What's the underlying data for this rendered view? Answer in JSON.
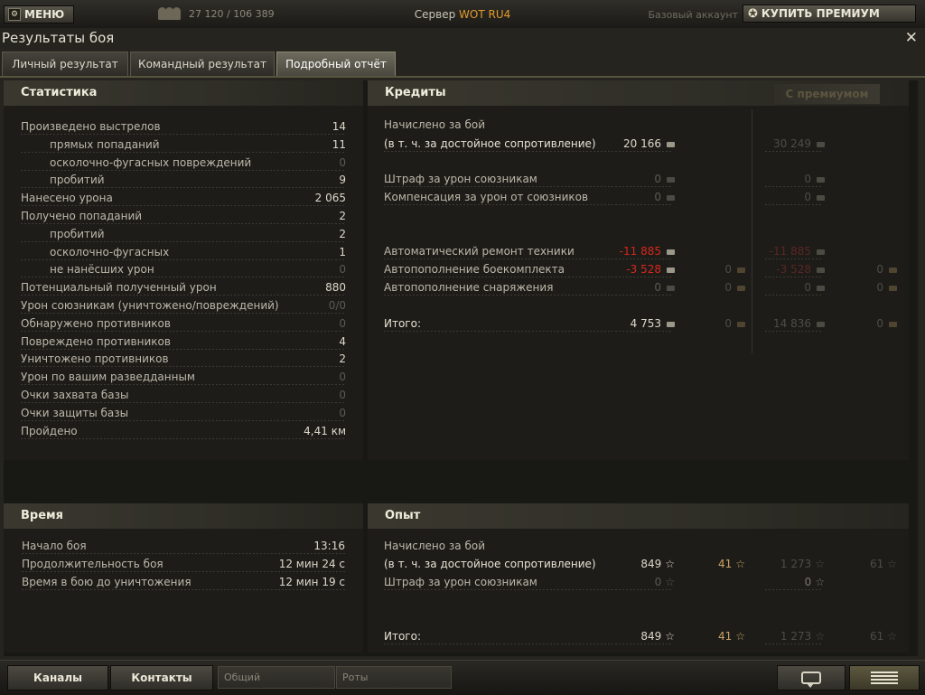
{
  "topbar": {
    "menu_label": "МЕНЮ",
    "players_online": "27 120 / 106 389",
    "server_prefix": "Сервер",
    "server_name": "WOT RU4",
    "account_type": "Базовый аккаунт",
    "premium_label": "КУПИТЬ ПРЕМИУМ"
  },
  "window": {
    "title": "Результаты боя",
    "close": "✕",
    "tabs": [
      "Личный результат",
      "Командный результат",
      "Подробный отчёт"
    ],
    "active_tab": 2
  },
  "statistics": {
    "title": "Статистика",
    "rows": [
      {
        "label": "Произведено выстрелов",
        "value": "14"
      },
      {
        "label": "прямых попаданий",
        "value": "11",
        "sub": true
      },
      {
        "label": "осколочно-фугасных повреждений",
        "value": "0",
        "sub": true,
        "dim": true
      },
      {
        "label": "пробитий",
        "value": "9",
        "sub": true
      },
      {
        "label": "Нанесено урона",
        "value": "2 065"
      },
      {
        "label": "Получено попаданий",
        "value": "2"
      },
      {
        "label": "пробитий",
        "value": "2",
        "sub": true
      },
      {
        "label": "осколочно-фугасных",
        "value": "1",
        "sub": true
      },
      {
        "label": "не нанёсших урон",
        "value": "0",
        "sub": true,
        "dim": true
      },
      {
        "label": "Потенциальный полученный урон",
        "value": "880"
      },
      {
        "label": "Урон союзникам (уничтожено/повреждений)",
        "value": "0/0",
        "dim": true
      },
      {
        "label": "Обнаружено противников",
        "value": "0",
        "dim": true
      },
      {
        "label": "Повреждено противников",
        "value": "4"
      },
      {
        "label": "Уничтожено противников",
        "value": "2"
      },
      {
        "label": "Урон по вашим разведданным",
        "value": "0",
        "dim": true
      },
      {
        "label": "Очки захвата базы",
        "value": "0",
        "dim": true
      },
      {
        "label": "Очки защиты базы",
        "value": "0",
        "dim": true
      },
      {
        "label": "Пройдено",
        "value": "4,41 км"
      }
    ]
  },
  "credits": {
    "title": "Кредиты",
    "premium_title": "С премиумом",
    "earned_label": "Начислено за бой",
    "earned_sub_label": "(в т. ч. за достойное сопротивление)",
    "earned": "20 166",
    "earned_prem": "30 249",
    "rows": [
      {
        "label": "Штраф за урон союзникам",
        "v1": "0",
        "p1": "0"
      },
      {
        "label": "Компенсация за урон от союзников",
        "v1": "0",
        "p1": "0"
      },
      {
        "label": "Автоматический ремонт техники",
        "v1": "-11 885",
        "p1": "-11 885",
        "red": true
      },
      {
        "label": "Автопополнение боекомплекта",
        "v1": "-3 528",
        "v2": "0",
        "p1": "-3 528",
        "p2": "0",
        "red": true
      },
      {
        "label": "Автопополнение снаряжения",
        "v1": "0",
        "v2": "0",
        "p1": "0",
        "p2": "0"
      }
    ],
    "total_label": "Итого:",
    "total": "4 753",
    "total_gold": "0",
    "total_prem": "14 836",
    "total_prem_gold": "0"
  },
  "time": {
    "title": "Время",
    "rows": [
      {
        "label": "Начало боя",
        "value": "13:16"
      },
      {
        "label": "Продолжительность боя",
        "value": "12 мин 24 с"
      },
      {
        "label": "Время в бою до уничтожения",
        "value": "12 мин 19 с"
      }
    ]
  },
  "experience": {
    "title": "Опыт",
    "earned_label": "Начислено за бой",
    "earned_sub_label": "(в т. ч. за достойное сопротивление)",
    "earned": "849",
    "earned_free": "41",
    "earned_prem": "1 273",
    "earned_prem_free": "61",
    "penalty_label": "Штраф за урон союзникам",
    "penalty": "0",
    "penalty_prem": "0",
    "total_label": "Итого:",
    "total": "849",
    "total_free": "41",
    "total_prem": "1 273",
    "total_prem_free": "61"
  },
  "bottombar": {
    "channels_label": "Каналы",
    "contacts_label": "Контакты",
    "general_channel": "Общий",
    "companies_channel": "Роты"
  },
  "colors": {
    "accent_orange": "#e49a2a",
    "negative_red": "#d7271e",
    "gold": "#c9a466"
  },
  "icons": {
    "credit": "credit-coin-icon",
    "gold": "gold-coin-icon",
    "xp": "xp-star-icon",
    "free_xp": "free-xp-star-icon"
  }
}
